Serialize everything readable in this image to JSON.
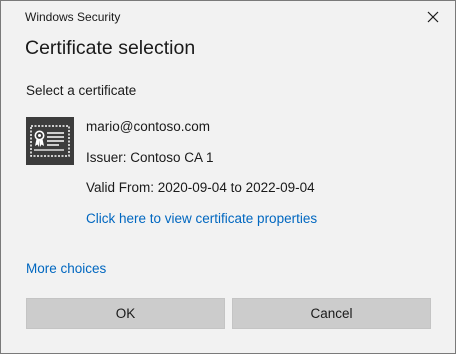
{
  "window": {
    "title": "Windows Security",
    "close_icon": "close-icon"
  },
  "dialog": {
    "heading": "Certificate selection",
    "prompt": "Select a certificate"
  },
  "certificate": {
    "icon": "certificate-icon",
    "subject": "mario@contoso.com",
    "issuer": "Issuer: Contoso CA 1",
    "validity": "Valid From: 2020-09-04 to 2022-09-04",
    "properties_link": "Click here to view certificate properties"
  },
  "more_choices": "More choices",
  "buttons": {
    "ok": "OK",
    "cancel": "Cancel"
  },
  "colors": {
    "background": "#f2f2f2",
    "link": "#0067c0",
    "button": "#cccccc",
    "icon_dark": "#3c3c3c"
  }
}
